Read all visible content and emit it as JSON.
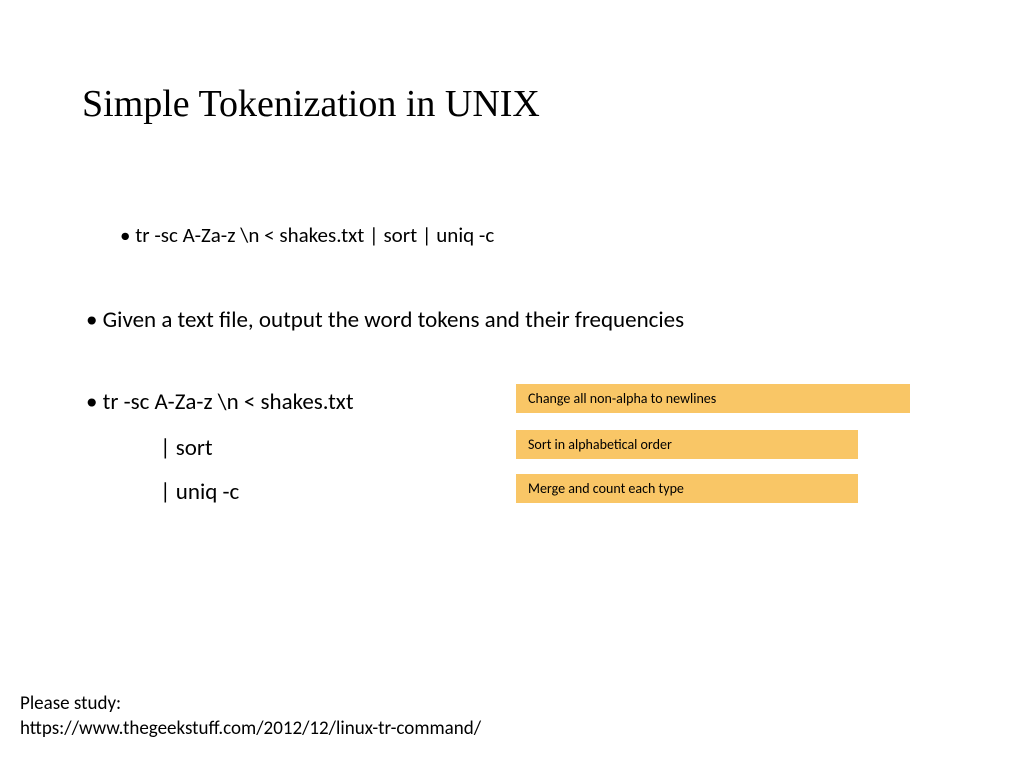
{
  "title": "Simple Tokenization in UNIX",
  "command_line": "tr -sc A-Za-z \\n < shakes.txt | sort | uniq -c",
  "description": "Given a text file, output the word tokens and their frequencies",
  "steps": {
    "step1": "tr -sc A-Za-z \\n < shakes.txt",
    "step2": "| sort",
    "step3": "| uniq -c"
  },
  "annotations": {
    "a1": "Change all non-alpha to newlines",
    "a2": "Sort in alphabetical order",
    "a3": "Merge and count each type"
  },
  "footer": {
    "line1": "Please study:",
    "line2": "https://www.thegeekstuff.com/2012/12/linux-tr-command/"
  }
}
